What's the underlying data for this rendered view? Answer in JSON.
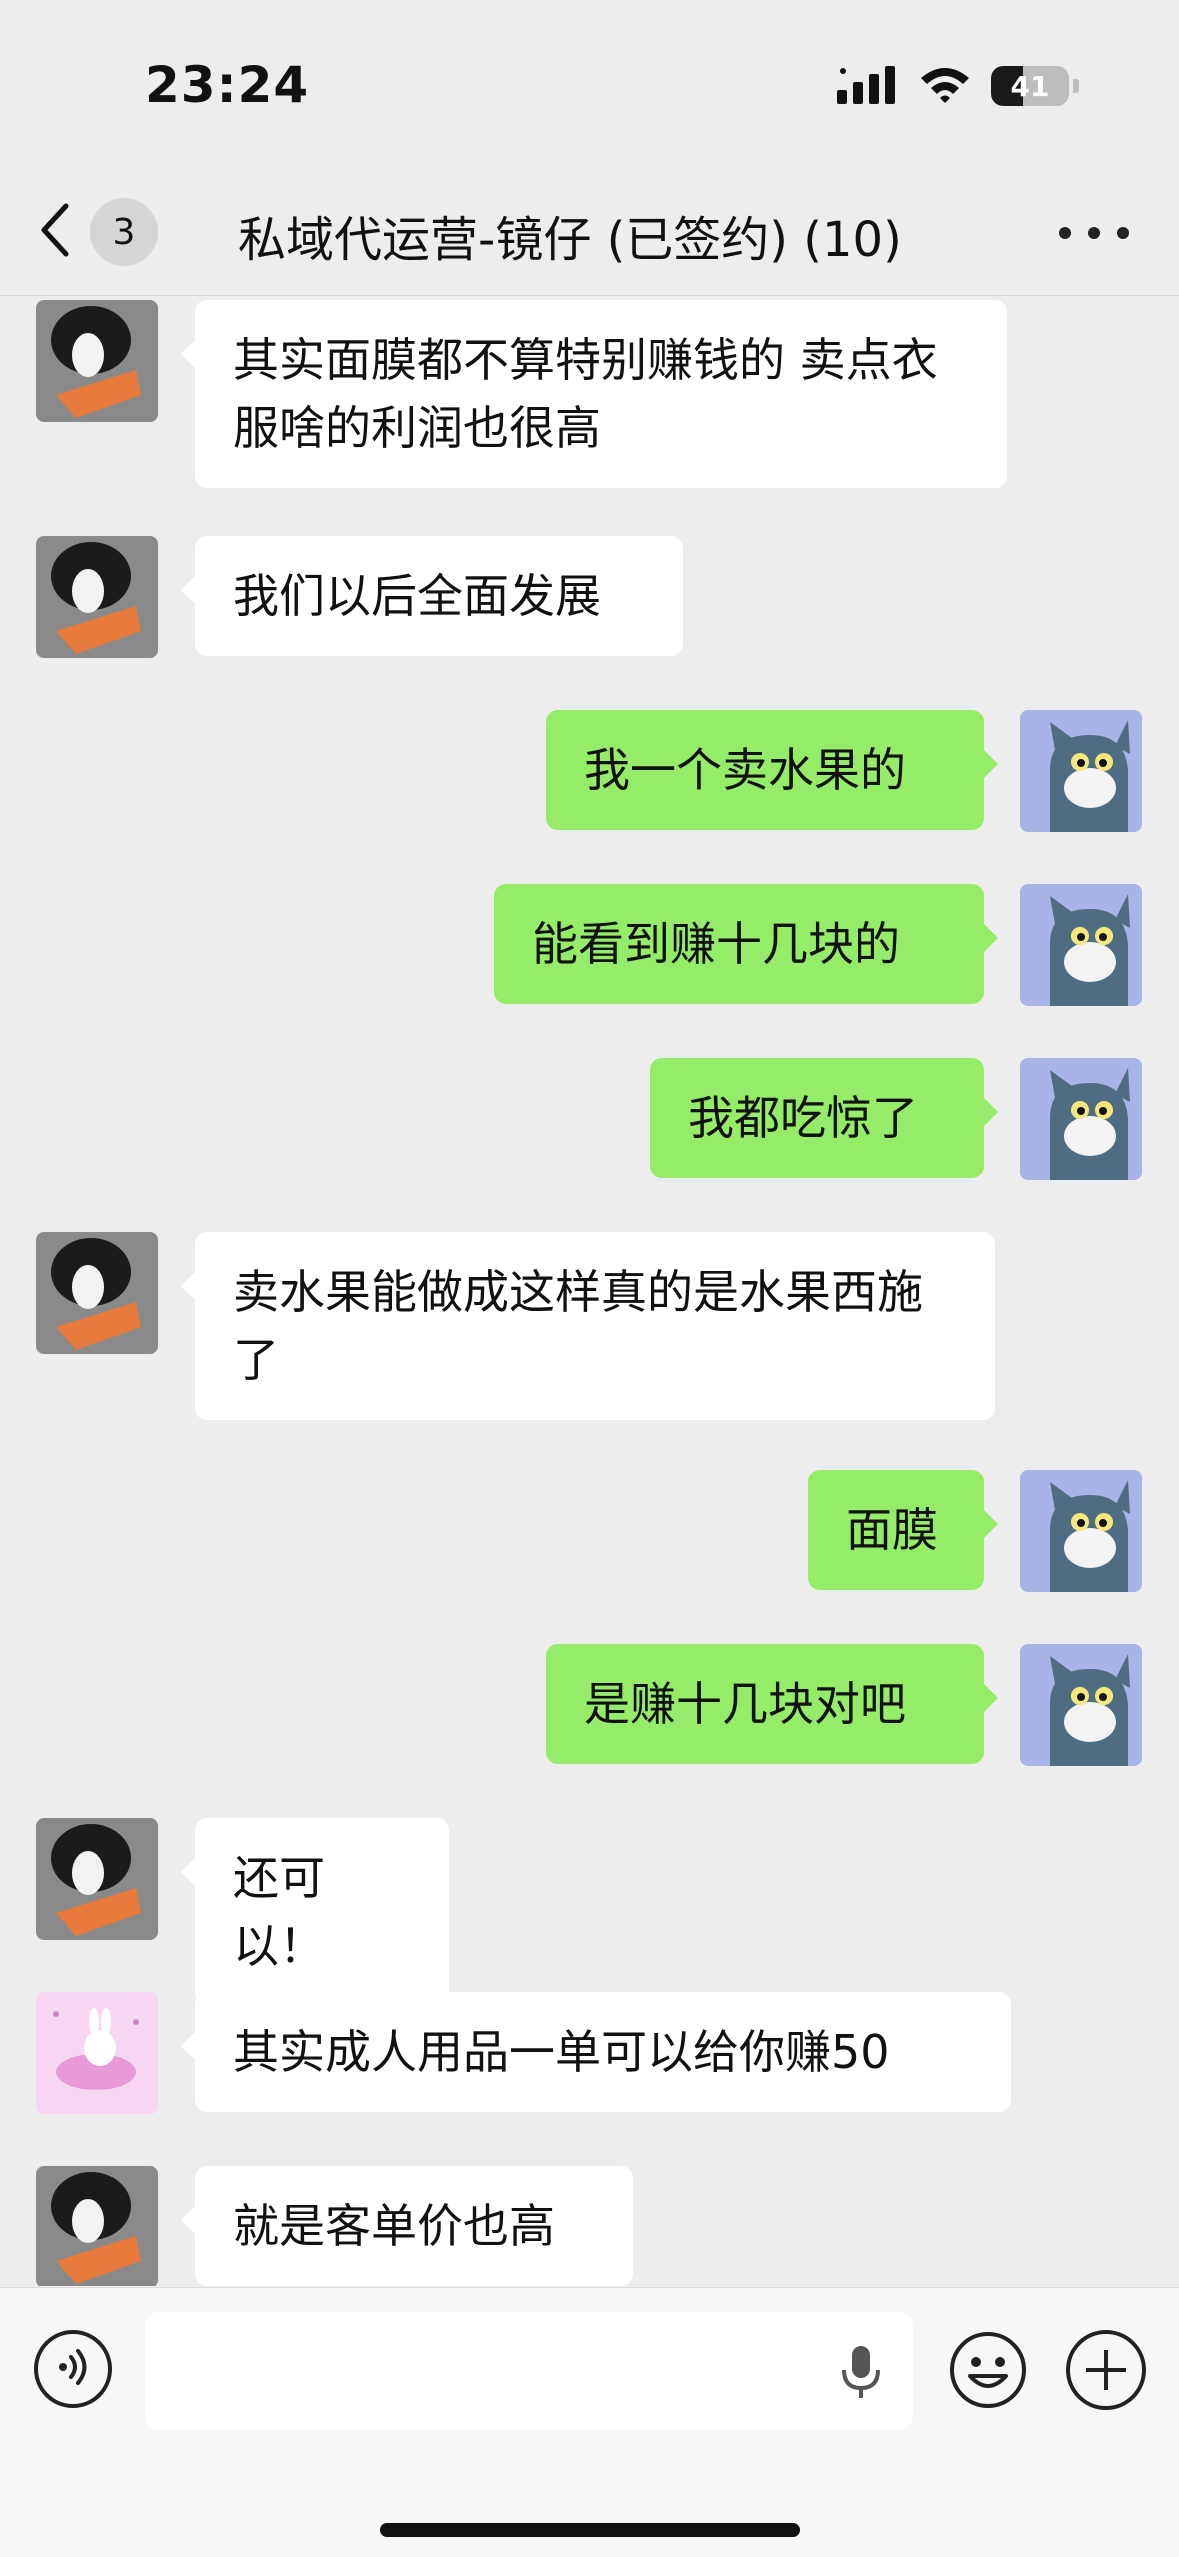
{
  "status_bar": {
    "time": "23:24",
    "battery": "41",
    "battery_level_percent": 41
  },
  "nav": {
    "unread_count": "3",
    "title": "私域代运营-镜仔 (已签约) (10)"
  },
  "messages": [
    {
      "side": "left",
      "avatar": "dog-avatar",
      "text": "其实面膜都不算特别赚钱的 卖点衣服啥的利润也很高"
    },
    {
      "side": "left",
      "avatar": "dog-avatar",
      "text": "我们以后全面发展"
    },
    {
      "side": "right",
      "avatar": "cat-avatar",
      "text": "我一个卖水果的"
    },
    {
      "side": "right",
      "avatar": "cat-avatar",
      "text": "能看到赚十几块的"
    },
    {
      "side": "right",
      "avatar": "cat-avatar",
      "text": "我都吃惊了"
    },
    {
      "side": "left",
      "avatar": "dog-avatar",
      "text": "卖水果能做成这样真的是水果西施了"
    },
    {
      "side": "right",
      "avatar": "cat-avatar",
      "text": "面膜"
    },
    {
      "side": "right",
      "avatar": "cat-avatar",
      "text": "是赚十几块对吧"
    },
    {
      "side": "left",
      "avatar": "dog-avatar",
      "text": "还可以！"
    },
    {
      "side": "left",
      "avatar": "bunny-avatar",
      "text": "其实成人用品一单可以给你赚50"
    },
    {
      "side": "left",
      "avatar": "dog-avatar",
      "text": "就是客单价也高"
    }
  ],
  "colors": {
    "background": "#ededed",
    "sent_bubble": "#95ec69",
    "received_bubble": "#ffffff"
  }
}
